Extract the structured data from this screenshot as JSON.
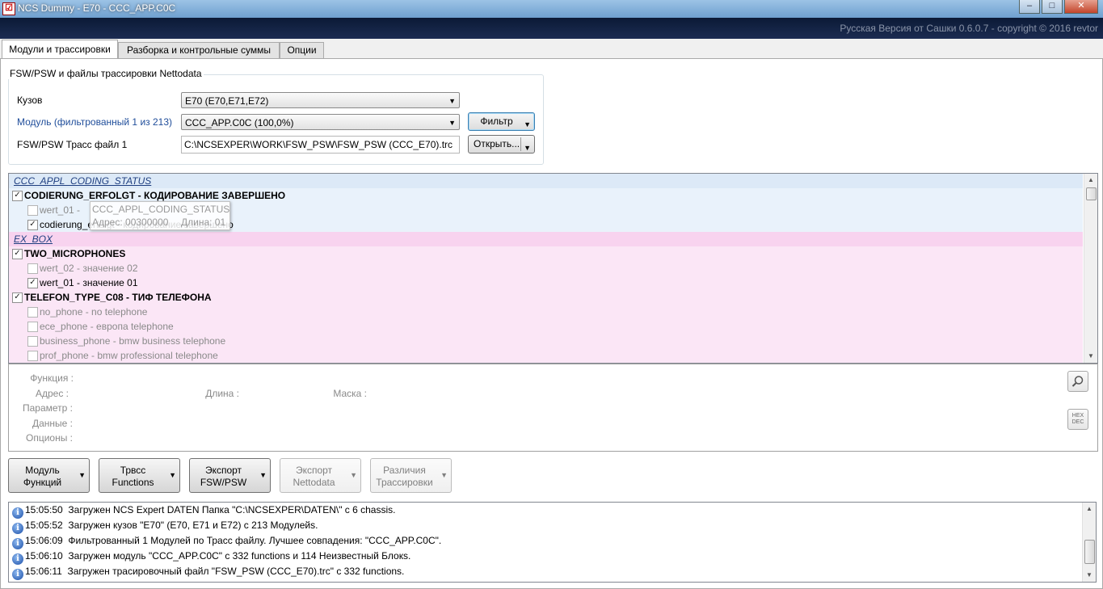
{
  "window": {
    "title": "NCS Dummy - E70 - CCC_APP.C0C",
    "copyright": "Русская Версия от Сашки 0.6.0.7 - copyright © 2016 revtor"
  },
  "tabs": [
    "Модули и трассировки",
    "Разборка и контрольные суммы",
    "Опции"
  ],
  "group": {
    "title": "FSW/PSW и файлы трассировки Nettodata",
    "chassis_label": "Кузов",
    "chassis_value": "E70  (E70,E71,E72)",
    "module_label": "Модуль (фильтрованный 1 из 213)",
    "module_value": "CCC_APP.C0C  (100,0%)",
    "trace_label": "FSW/PSW Трасс файл 1",
    "trace_value": "C:\\NCSEXPER\\WORK\\FSW_PSW\\FSW_PSW (CCC_E70).trc",
    "filter_button": "Фильтр",
    "open_button": "Открыть..."
  },
  "tree": {
    "rows": [
      {
        "type": "category",
        "text": "CCC_APPL_CODING_STATUS"
      },
      {
        "type": "parameter",
        "text": "CODIERUNG_ERFOLGT  -  КОДИРОВАНИЕ ЗАВЕРШЕНО",
        "checked": true
      },
      {
        "type": "value",
        "text": "wert_01  -  ",
        "checked": false
      },
      {
        "type": "value",
        "text": "codierung_erfolgt  -  кодирование завершено",
        "checked": true
      },
      {
        "type": "category",
        "text": "EX_BOX"
      },
      {
        "type": "parameter",
        "text": "TWO_MICROPHONES",
        "checked": true
      },
      {
        "type": "value",
        "text": "wert_02  -  значение 02",
        "checked": false
      },
      {
        "type": "value",
        "text": "wert_01  -  значение 01",
        "checked": true
      },
      {
        "type": "parameter",
        "text": "TELEFON_TYPE_C08  -  ТИФ ТЕЛЕФОНА",
        "checked": true
      },
      {
        "type": "value",
        "text": "no_phone  -  no telephone",
        "checked": false
      },
      {
        "type": "value",
        "text": "ece_phone  -  европа telephone",
        "checked": false
      },
      {
        "type": "value",
        "text": "business_phone  -  bmw business telephone",
        "checked": false
      },
      {
        "type": "value",
        "text": "prof_phone  -  bmw professional telephone",
        "checked": false
      }
    ],
    "tooltip": {
      "line1": "CCC_APPL_CODING_STATUS",
      "addr": "Адрес: 00300000",
      "len": "Длина: 01"
    }
  },
  "details": {
    "function": "Функция :",
    "address": "Адрес :",
    "length": "Длина :",
    "mask": "Маска :",
    "parameter": "Параметр :",
    "data": "Данные :",
    "options": "Опционы :",
    "hexdec_line1": "HEX",
    "hexdec_line2": "DEC"
  },
  "buttons": [
    {
      "l1": "Модуль",
      "l2": "Функций",
      "enabled": true
    },
    {
      "l1": "Трвсс",
      "l2": "Functions",
      "enabled": true
    },
    {
      "l1": "Экспорт",
      "l2": "FSW/PSW",
      "enabled": true
    },
    {
      "l1": "Экспорт",
      "l2": "Nettodata",
      "enabled": false
    },
    {
      "l1": "Различия",
      "l2": "Трассировки",
      "enabled": false
    }
  ],
  "log": [
    {
      "time": "15:05:50",
      "text": "Загружен NCS Expert DATEN Папка \"C:\\NCSEXPER\\DATEN\\\" с 6 chassis."
    },
    {
      "time": "15:05:52",
      "text": "Загружен кузов \"E70\" (E70, E71 и E72) с 213 Модулейs."
    },
    {
      "time": "15:06:09",
      "text": "Фильтрованный 1 Модулей по Трасс файлу. Лучшее совпадения: \"CCC_APP.C0C\"."
    },
    {
      "time": "15:06:10",
      "text": "Загружен модуль \"CCC_APP.C0C\" с 332 functions и 114 Неизвестный Блокs."
    },
    {
      "time": "15:06:11",
      "text": "Загружен трасировочный файл \"FSW_PSW (CCC_E70).trc\" с 332 functions."
    }
  ],
  "icons": {
    "app": "app-icon",
    "search": "magnifier-icon",
    "info": "info-icon",
    "dropdown": "chevron-down-icon"
  }
}
